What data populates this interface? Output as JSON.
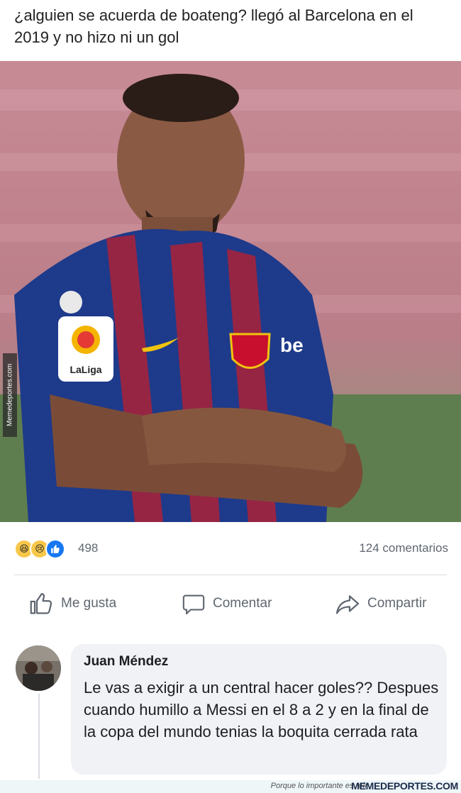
{
  "post": {
    "text": "¿alguien se acuerda de boateng? llegó al Barcelona en el 2019 y no hizo ni un gol"
  },
  "photo": {
    "jersey_sponsor_partial": "be",
    "badge_text": "LaLiga"
  },
  "watermark_side": "Memedeportes.com",
  "reactions": {
    "icons": [
      "haha-icon",
      "sad-icon",
      "like-icon"
    ],
    "count": "498",
    "comments": "124 comentarios"
  },
  "actions": {
    "like": "Me gusta",
    "comment": "Comentar",
    "share": "Compartir"
  },
  "comment": {
    "author": "Juan Méndez",
    "text": "Le vas a exigir a un central hacer goles?? Despues cuando humillo a Messi en el 8 a 2 y en la final de la copa del mundo tenias la boquita cerrada rata"
  },
  "footer": {
    "note": "Porque lo importante es reír",
    "brand": "MEMEDEPORTES.COM"
  },
  "colors": {
    "like_blue": "#1877f2",
    "muted_text": "#606770",
    "bubble_bg": "#f0f2f5"
  }
}
